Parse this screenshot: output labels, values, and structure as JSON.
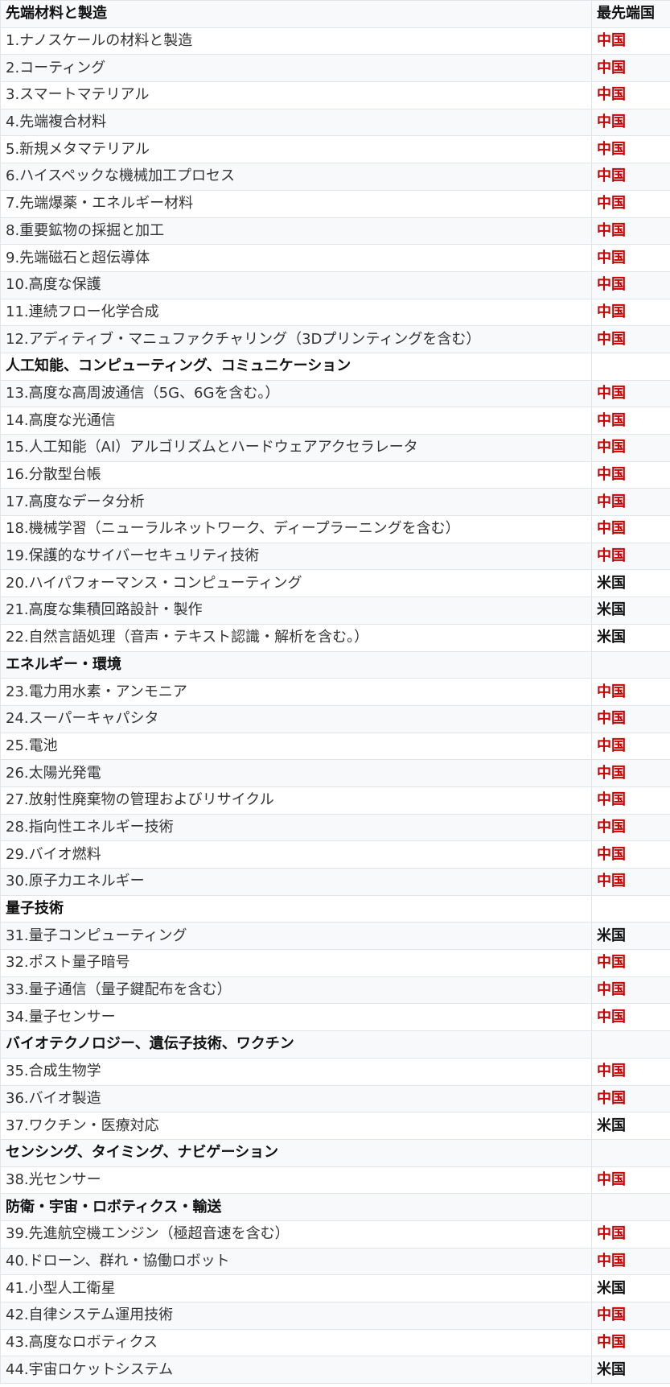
{
  "header": {
    "label": "先端材料と製造",
    "country_header": "最先端国"
  },
  "rows": [
    {
      "label": "1.ナノスケールの材料と製造",
      "country": "中国"
    },
    {
      "label": "2.コーティング",
      "country": "中国"
    },
    {
      "label": "3.スマートマテリアル",
      "country": "中国"
    },
    {
      "label": "4.先端複合材料",
      "country": "中国"
    },
    {
      "label": "5.新規メタマテリアル",
      "country": "中国"
    },
    {
      "label": "6.ハイスペックな機械加工プロセス",
      "country": "中国"
    },
    {
      "label": "7.先端爆薬・エネルギー材料",
      "country": "中国"
    },
    {
      "label": "8.重要鉱物の採掘と加工",
      "country": "中国"
    },
    {
      "label": "9.先端磁石と超伝導体",
      "country": "中国"
    },
    {
      "label": "10.高度な保護",
      "country": "中国"
    },
    {
      "label": "11.連続フロー化学合成",
      "country": "中国"
    },
    {
      "label": "12.アディティブ・マニュファクチャリング（3Dプリンティングを含む）",
      "country": "中国"
    },
    {
      "label": "人工知能、コンピューティング、コミュニケーション",
      "country": "",
      "section": true
    },
    {
      "label": "13.高度な高周波通信（5G、6Gを含む。）",
      "country": "中国"
    },
    {
      "label": "14.高度な光通信",
      "country": "中国"
    },
    {
      "label": "15.人工知能（AI）アルゴリズムとハードウェアアクセラレータ",
      "country": "中国"
    },
    {
      "label": "16.分散型台帳",
      "country": "中国"
    },
    {
      "label": "17.高度なデータ分析",
      "country": "中国"
    },
    {
      "label": "18.機械学習（ニューラルネットワーク、ディープラーニングを含む）",
      "country": "中国"
    },
    {
      "label": "19.保護的なサイバーセキュリティ技術",
      "country": "中国"
    },
    {
      "label": "20.ハイパフォーマンス・コンピューティング",
      "country": "米国"
    },
    {
      "label": "21.高度な集積回路設計・製作",
      "country": "米国"
    },
    {
      "label": "22.自然言語処理（音声・テキスト認識・解析を含む。）",
      "country": "米国"
    },
    {
      "label": "エネルギー・環境",
      "country": "",
      "section": true
    },
    {
      "label": "23.電力用水素・アンモニア",
      "country": "中国"
    },
    {
      "label": "24.スーパーキャパシタ",
      "country": "中国"
    },
    {
      "label": "25.電池",
      "country": "中国"
    },
    {
      "label": "26.太陽光発電",
      "country": "中国"
    },
    {
      "label": "27.放射性廃棄物の管理およびリサイクル",
      "country": "中国"
    },
    {
      "label": "28.指向性エネルギー技術",
      "country": "中国"
    },
    {
      "label": "29.バイオ燃料",
      "country": "中国"
    },
    {
      "label": "30.原子力エネルギー",
      "country": "中国"
    },
    {
      "label": "量子技術",
      "country": "",
      "section": true
    },
    {
      "label": "31.量子コンピューティング",
      "country": "米国"
    },
    {
      "label": "32.ポスト量子暗号",
      "country": "中国"
    },
    {
      "label": "33.量子通信（量子鍵配布を含む）",
      "country": "中国"
    },
    {
      "label": "34.量子センサー",
      "country": "中国"
    },
    {
      "label": "バイオテクノロジー、遺伝子技術、ワクチン",
      "country": "",
      "section": true
    },
    {
      "label": "35.合成生物学",
      "country": "中国"
    },
    {
      "label": "36.バイオ製造",
      "country": "中国"
    },
    {
      "label": "37.ワクチン・医療対応",
      "country": "米国"
    },
    {
      "label": "センシング、タイミング、ナビゲーション",
      "country": "",
      "section": true
    },
    {
      "label": "38.光センサー",
      "country": "中国"
    },
    {
      "label": "防衛・宇宙・ロボティクス・輸送",
      "country": "",
      "section": true
    },
    {
      "label": "39.先進航空機エンジン（極超音速を含む）",
      "country": "中国"
    },
    {
      "label": "40.ドローン、群れ・協働ロボット",
      "country": "中国"
    },
    {
      "label": "41.小型人工衛星",
      "country": "米国"
    },
    {
      "label": "42.自律システム運用技術",
      "country": "中国"
    },
    {
      "label": "43.高度なロボティクス",
      "country": "中国"
    },
    {
      "label": "44.宇宙ロケットシステム",
      "country": "米国"
    }
  ],
  "colors": {
    "china": "#cc0000",
    "usa": "#111111",
    "stripe": "#f7f9fb",
    "border": "#e1e4e8"
  }
}
